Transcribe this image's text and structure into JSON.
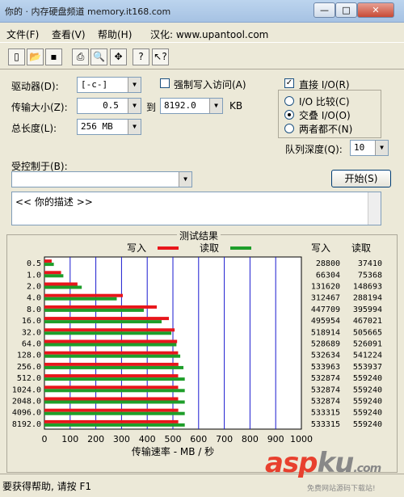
{
  "window": {
    "title": "你的 · 内存硬盘频道 memory.it168.com",
    "btn_min": "—",
    "btn_max": "□",
    "btn_close": "✕"
  },
  "menu": {
    "file": "文件(F)",
    "view": "查看(V)",
    "help": "帮助(H)",
    "localized": "汉化: www.upantool.com"
  },
  "toolbar": {
    "icons": [
      "new-icon",
      "open-icon",
      "save-icon",
      "print-icon",
      "print-preview-icon",
      "move-icon",
      "help-icon",
      "context-help-icon"
    ]
  },
  "form": {
    "drive_label": "驱动器(D):",
    "drive_value": "[-c-]",
    "transfer_size_label": "传输大小(Z):",
    "transfer_from": "0.5",
    "to_label": "到",
    "transfer_to": "8192.0",
    "kb_label": "KB",
    "total_length_label": "总长度(L):",
    "total_length_value": "256 MB",
    "force_write_label": "强制写入访问(A)",
    "direct_io_label": "直接 I/O(R)",
    "io_compare_label": "I/O 比较(C)",
    "overlapped_io_label": "交叠 I/O(O)",
    "neither_label": "两者都不(N)",
    "queue_depth_label": "队列深度(Q):",
    "queue_depth_value": "10",
    "controlled_by_label": "受控制于(B):",
    "controlled_by_value": "",
    "start_button": "开始(S)",
    "description": "<<   你的描述   >>"
  },
  "results": {
    "caption": "测试结果"
  },
  "chart_data": {
    "type": "bar",
    "title": "测试结果",
    "xlabel": "传输速率 - MB / 秒",
    "xlim": [
      0,
      1000
    ],
    "xticks": [
      0,
      100,
      200,
      300,
      400,
      500,
      600,
      700,
      800,
      900,
      1000
    ],
    "categories": [
      "0.5",
      "1.0",
      "2.0",
      "4.0",
      "8.0",
      "16.0",
      "32.0",
      "64.0",
      "128.0",
      "256.0",
      "512.0",
      "1024.0",
      "2048.0",
      "4096.0",
      "8192.0"
    ],
    "series": [
      {
        "name": "写入",
        "color": "#e8161b",
        "values": [
          28800,
          66304,
          131620,
          312467,
          447709,
          495954,
          518914,
          528689,
          532634,
          533963,
          532874,
          532874,
          532874,
          533315,
          533315
        ]
      },
      {
        "name": "读取",
        "color": "#1e9e2a",
        "values": [
          37410,
          75368,
          148693,
          288194,
          395994,
          467021,
          505665,
          526091,
          541224,
          553937,
          559240,
          559240,
          559240,
          559240,
          559240
        ]
      }
    ],
    "column_headers": [
      "写入",
      "读取"
    ],
    "legend": "top"
  },
  "status": {
    "text": "要获得帮助, 请按 F1"
  },
  "watermark": {
    "asp": "asp",
    "ku": "ku",
    "net": ".com",
    "sub": "免费网站源码下载站!"
  }
}
